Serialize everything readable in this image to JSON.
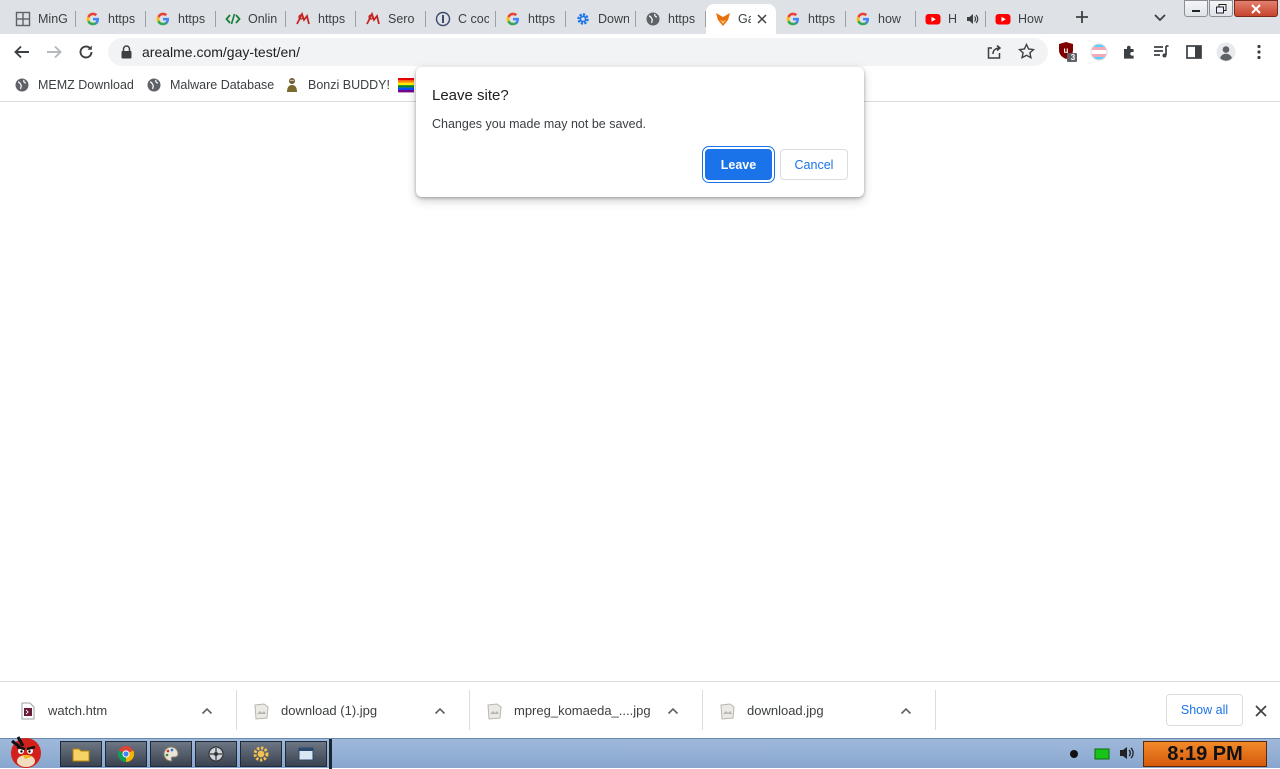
{
  "tabs": [
    {
      "title": "MinG",
      "icon": "grid-icon"
    },
    {
      "title": "https",
      "icon": "google-icon"
    },
    {
      "title": "https",
      "icon": "google-icon"
    },
    {
      "title": "Onlin",
      "icon": "code-icon"
    },
    {
      "title": "https",
      "icon": "red-sig-icon"
    },
    {
      "title": "Sero",
      "icon": "red-sig-icon"
    },
    {
      "title": "C coc",
      "icon": "info-globe-icon"
    },
    {
      "title": "https",
      "icon": "google-icon"
    },
    {
      "title": "Down",
      "icon": "gear-icon"
    },
    {
      "title": "https",
      "icon": "globe-icon"
    },
    {
      "title": "Ga",
      "icon": "fox-icon",
      "active": true
    },
    {
      "title": "https",
      "icon": "google-icon"
    },
    {
      "title": "how",
      "icon": "google-icon"
    },
    {
      "title": "H",
      "icon": "youtube-icon",
      "audio": true
    },
    {
      "title": "How",
      "icon": "youtube-icon"
    }
  ],
  "toolbar": {
    "url": "arealme.com/gay-test/en/",
    "extension_badge": "3"
  },
  "bookmarks": [
    {
      "label": "MEMZ Download",
      "icon": "globe-icon"
    },
    {
      "label": "Malware Database",
      "icon": "globe-icon"
    },
    {
      "label": "Bonzi BUDDY!",
      "icon": "bonzi-icon"
    },
    {
      "label": "",
      "icon": "rainbow-flag-icon"
    }
  ],
  "dialog": {
    "title": "Leave site?",
    "message": "Changes you made may not be saved.",
    "leave_label": "Leave",
    "cancel_label": "Cancel"
  },
  "downloads": {
    "items": [
      {
        "name": "watch.htm",
        "icon": "html-file-icon"
      },
      {
        "name": "download (1).jpg",
        "icon": "image-file-icon"
      },
      {
        "name": "mpreg_komaeda_....jpg",
        "icon": "image-file-icon"
      },
      {
        "name": "download.jpg",
        "icon": "image-file-icon"
      }
    ],
    "show_all_label": "Show all"
  },
  "taskbar": {
    "clock": "8:19 PM"
  },
  "colors": {
    "accent": "#1a73e8",
    "tabstrip": "#dee1e6",
    "taskbar": "#9fb9da",
    "clock": "#f18a2a"
  }
}
